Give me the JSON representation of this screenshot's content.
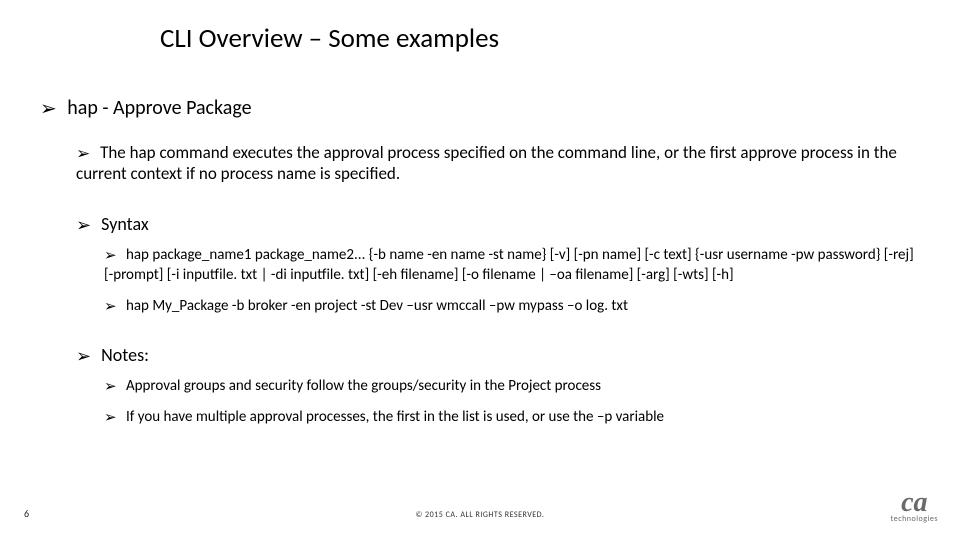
{
  "title": "CLI Overview – Some examples",
  "bullet_marker": "➢",
  "section": {
    "heading": "hap - Approve Package",
    "description": "The hap command executes the approval process specified on the command line, or the first approve process in the current context if no process name is specified.",
    "syntax_label": "Syntax",
    "syntax_items": [
      "hap package_name1 package_name2... {-b name -en name -st name} [-v] [-pn name] [-c text] {-usr username -pw password} [-rej] [-prompt] [-i inputfile. txt | -di inputfile. txt] [-eh filename] [-o filename | –oa filename] [-arg] [-wts] [-h]",
      "hap My_Package -b broker -en project -st Dev –usr wmccall –pw mypass –o log. txt"
    ],
    "notes_label": "Notes:",
    "notes_items": [
      "Approval groups and security follow the groups/security in the Project process",
      "If you have multiple approval processes, the first in the list is used, or use the –p variable"
    ]
  },
  "footer": {
    "page_number": "6",
    "copyright": "© 2015 CA. ALL RIGHTS RESERVED.",
    "logo_main": "ca",
    "logo_sub": "technologies"
  }
}
